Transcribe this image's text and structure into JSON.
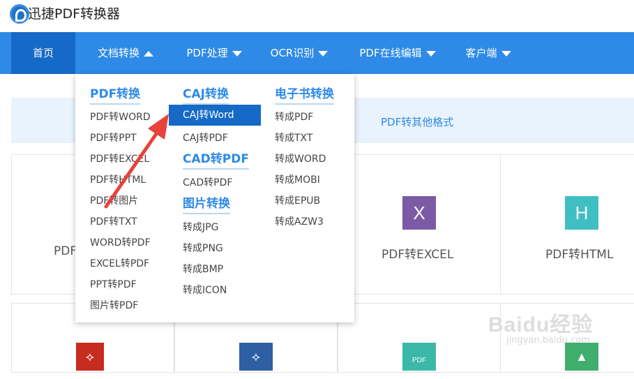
{
  "app": {
    "title": "迅捷PDF转换器"
  },
  "nav": {
    "items": [
      {
        "label": "首页"
      },
      {
        "label": "文档转换"
      },
      {
        "label": "PDF处理"
      },
      {
        "label": "OCR识别"
      },
      {
        "label": "PDF在线编辑"
      },
      {
        "label": "客户端"
      }
    ]
  },
  "banner": {
    "tab_label": "PDF转其他格式"
  },
  "cards": [
    {
      "label": "PDF"
    },
    {
      "label": "PDF转EXCEL",
      "tile_letter": "X",
      "tile_color": "#7b5ba6"
    },
    {
      "label": "PDF转HTML",
      "tile_letter": "H",
      "tile_color": "#3fbfc3"
    }
  ],
  "bottom_tiles": [
    {
      "icon": "pdf-acrobat-icon",
      "color": "#c62d1f"
    },
    {
      "icon": "pdf-file-icon",
      "color": "#2e5fa3"
    },
    {
      "icon": "pdf-doc-icon",
      "color": "#3cb8a8",
      "text": "PDF"
    },
    {
      "icon": "image-icon",
      "color": "#3fae6e"
    }
  ],
  "dropdown": {
    "col1": {
      "title": "PDF转换",
      "items": [
        "PDF转WORD",
        "PDF转PPT",
        "PDF转EXCEL",
        "PDF转HTML",
        "PDF转图片",
        "PDF转TXT",
        "WORD转PDF",
        "EXCEL转PDF",
        "PPT转PDF",
        "图片转PDF"
      ]
    },
    "col2": {
      "sections": [
        {
          "title": "CAJ转换",
          "items": [
            "CAJ转Word",
            "CAJ转PDF"
          ]
        },
        {
          "title": "CAD转PDF",
          "items": [
            "CAD转PDF"
          ]
        },
        {
          "title": "图片转换",
          "items": [
            "转成JPG",
            "转成PNG",
            "转成BMP",
            "转成ICON"
          ]
        }
      ]
    },
    "col3": {
      "title": "电子书转换",
      "items": [
        "转成PDF",
        "转成TXT",
        "转成WORD",
        "转成MOBI",
        "转成EPUB",
        "转成AZW3"
      ]
    }
  },
  "watermark": {
    "main": "Baidu经验",
    "sub": "jingyan.baidu.com"
  },
  "colors": {
    "nav_bg": "#2e8ae6",
    "nav_active": "#1569c7",
    "accent": "#2e8ae6",
    "arrow": "#e8423a"
  }
}
